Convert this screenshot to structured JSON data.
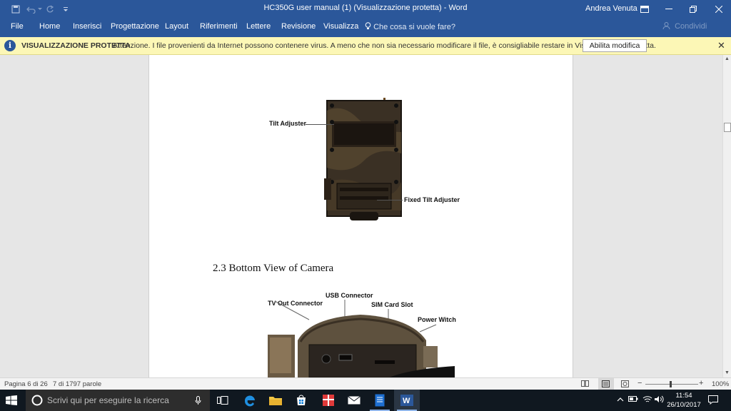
{
  "titlebar": {
    "title": "HC350G user manual (1) (Visualizzazione protetta)  -  Word",
    "user": "Andrea Venuta"
  },
  "ribbon": {
    "tabs": [
      "File",
      "Home",
      "Inserisci",
      "Progettazione",
      "Layout",
      "Riferimenti",
      "Lettere",
      "Revisione",
      "Visualizza"
    ],
    "tell_me": "Che cosa si vuole fare?",
    "share": "Condividi"
  },
  "protected_view": {
    "title": "VISUALIZZAZIONE PROTETTA",
    "message": "Attenzione. I file provenienti da Internet possono contenere virus. A meno che non sia necessario modificare il file, è consigliabile restare in Visualizzazione protetta.",
    "enable_button": "Abilita modifica"
  },
  "document": {
    "labels": {
      "tilt_adjuster": "Tilt Adjuster",
      "fixed_tilt_adjuster": "Fixed Tilt Adjuster",
      "usb_connector": "USB Connector",
      "tv_out_connector": "TV Out Connector",
      "sim_card_slot": "SIM Card Slot",
      "power_witch": "Power Witch"
    },
    "section_heading": "2.3 Bottom View of Camera"
  },
  "status": {
    "page": "Pagina 6 di 26",
    "words": "7 di 1797 parole",
    "zoom": "100%"
  },
  "taskbar": {
    "search_placeholder": "Scrivi qui per eseguire la ricerca",
    "time": "11:54",
    "date": "26/10/2017"
  },
  "colors": {
    "word_blue": "#2b579a",
    "protected_bar": "#fcf7b6",
    "taskbar": "#101820"
  }
}
